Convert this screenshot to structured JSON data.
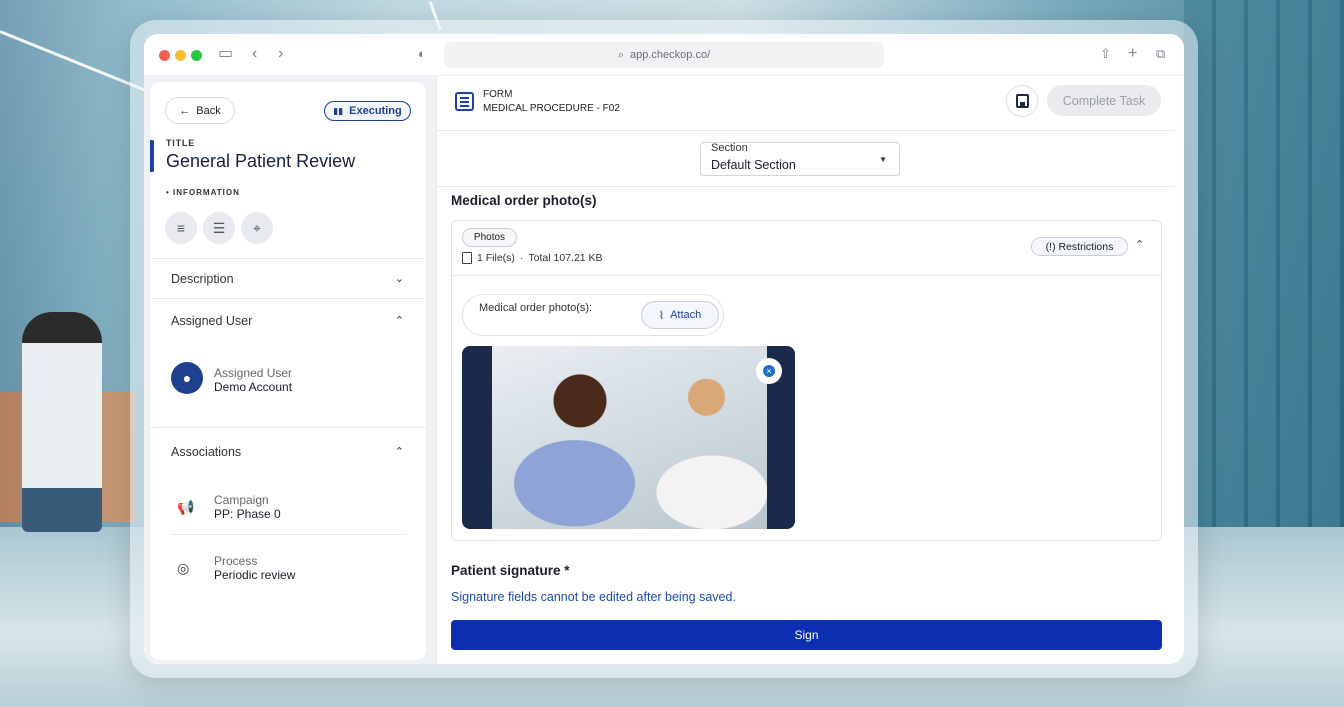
{
  "browser": {
    "url": "app.checkop.co/",
    "icons": [
      "sidebar-icon",
      "back-arrow-icon",
      "forward-arrow-icon",
      "shield-icon",
      "search-icon",
      "share-icon",
      "new-tab-icon",
      "tabs-icon"
    ]
  },
  "left": {
    "back_label": "Back",
    "status_label": "Executing",
    "title_label": "TITLE",
    "title_value": "General Patient Review",
    "info_label": "• INFORMATION",
    "sections": {
      "description": "Description",
      "assigned_user": "Assigned User",
      "associations": "Associations"
    },
    "assigned": {
      "label": "Assigned User",
      "value": "Demo Account"
    },
    "associations": [
      {
        "label": "Campaign",
        "value": "PP: Phase 0",
        "icon": "megaphone-icon"
      },
      {
        "label": "Process",
        "value": "Periodic review",
        "icon": "process-icon"
      }
    ]
  },
  "right": {
    "form_label": "FORM",
    "form_name": "MEDICAL PROCEDURE - F02",
    "complete_label": "Complete Task",
    "section_select": {
      "label": "Section",
      "value": "Default Section"
    },
    "photos": {
      "heading": "Medical order photo(s)",
      "chip": "Photos",
      "file_count": "1 File(s)",
      "separator": "·",
      "total": "Total 107.21 KB",
      "restrictions": "(!) Restrictions",
      "upload_label": "Medical order photo(s):",
      "attach_label": "Attach"
    },
    "signature": {
      "heading": "Patient signature *",
      "note": "Signature fields cannot be edited after being saved.",
      "sign_label": "Sign"
    }
  },
  "colors": {
    "accent": "#1d3fa8",
    "sign_button": "#0b2fb0",
    "disabled": "#e9ebee"
  }
}
